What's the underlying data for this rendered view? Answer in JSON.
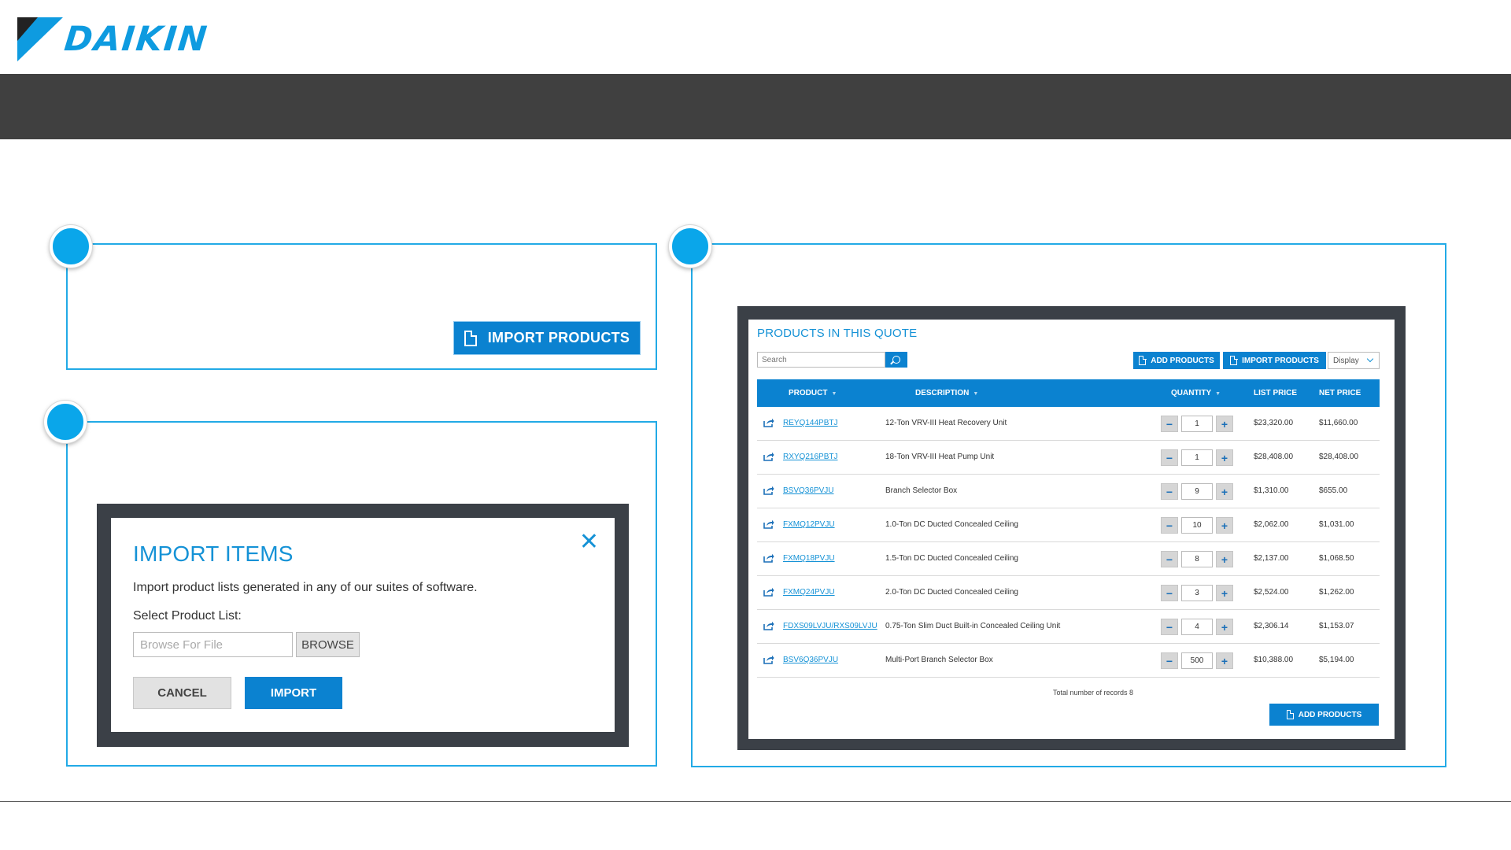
{
  "brand": {
    "name": "DAIKIN",
    "color": "#0e9be0"
  },
  "colors": {
    "accent": "#0b82d0",
    "frame": "#22aae6",
    "band": "#404040",
    "modal_bg": "#3b4047"
  },
  "callout1": {
    "import_button_label": "IMPORT PRODUCTS",
    "icon": "document-icon"
  },
  "modal": {
    "title": "IMPORT ITEMS",
    "close_icon": "close-icon",
    "description": "Import product lists generated in any of our suites of software.",
    "select_label": "Select Product List:",
    "file_placeholder": "Browse For File",
    "browse_label": "BROWSE",
    "cancel_label": "CANCEL",
    "import_label": "IMPORT"
  },
  "quote": {
    "title": "PRODUCTS IN THIS QUOTE",
    "search_placeholder": "Search",
    "add_products_label": "ADD PRODUCTS",
    "import_products_label": "IMPORT PRODUCTS",
    "display_label": "Display",
    "columns": {
      "product": "PRODUCT",
      "description": "DESCRIPTION",
      "quantity": "QUANTITY",
      "list_price": "LIST PRICE",
      "net_price": "NET PRICE"
    },
    "rows": [
      {
        "product": "REYQ144PBTJ",
        "description": "12-Ton VRV-III Heat Recovery Unit",
        "quantity": "1",
        "list_price": "$23,320.00",
        "net_price": "$11,660.00"
      },
      {
        "product": "RXYQ216PBTJ",
        "description": "18-Ton VRV-III Heat Pump Unit",
        "quantity": "1",
        "list_price": "$28,408.00",
        "net_price": "$28,408.00"
      },
      {
        "product": "BSVQ36PVJU",
        "description": "Branch Selector Box",
        "quantity": "9",
        "list_price": "$1,310.00",
        "net_price": "$655.00"
      },
      {
        "product": "FXMQ12PVJU",
        "description": "1.0-Ton DC Ducted Concealed Ceiling",
        "quantity": "10",
        "list_price": "$2,062.00",
        "net_price": "$1,031.00"
      },
      {
        "product": "FXMQ18PVJU",
        "description": "1.5-Ton DC Ducted Concealed Ceiling",
        "quantity": "8",
        "list_price": "$2,137.00",
        "net_price": "$1,068.50"
      },
      {
        "product": "FXMQ24PVJU",
        "description": "2.0-Ton DC Ducted Concealed Ceiling",
        "quantity": "3",
        "list_price": "$2,524.00",
        "net_price": "$1,262.00"
      },
      {
        "product": "FDXS09LVJU/RXS09LVJU",
        "description": "0.75-Ton Slim Duct Built-in Concealed Ceiling Unit",
        "quantity": "4",
        "list_price": "$2,306.14",
        "net_price": "$1,153.07"
      },
      {
        "product": "BSV6Q36PVJU",
        "description": "Multi-Port Branch Selector Box",
        "quantity": "500",
        "list_price": "$10,388.00",
        "net_price": "$5,194.00"
      }
    ],
    "total_text": "Total number of records 8",
    "bottom_add_label": "ADD PRODUCTS"
  }
}
